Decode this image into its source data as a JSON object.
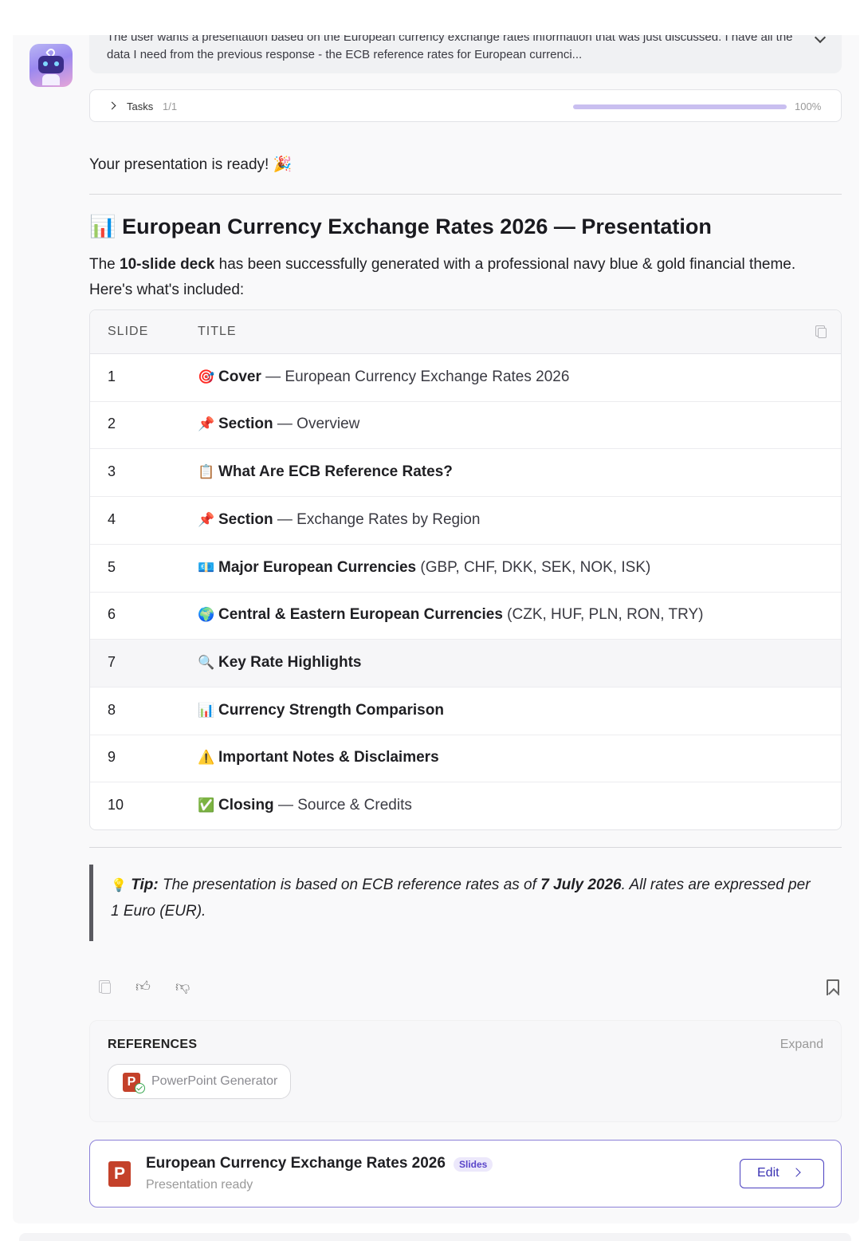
{
  "thinking": {
    "text": "The user wants a presentation based on the European currency exchange rates information that was just discussed. I have all the data I need from the previous response - the ECB reference rates for European currenci..."
  },
  "tasks": {
    "label": "Tasks",
    "count": "1/1",
    "progress": 100,
    "progress_label": "100%"
  },
  "message": {
    "ready": "Your presentation is ready! 🎉",
    "heading_emoji": "📊",
    "heading": "European Currency Exchange Rates 2026 — Presentation",
    "desc_pre": "The ",
    "desc_bold": "10-slide deck",
    "desc_post": " has been successfully generated with a professional navy blue & gold financial theme. Here's what's included:"
  },
  "table": {
    "headers": [
      "SLIDE",
      "TITLE"
    ],
    "rows": [
      {
        "num": "1",
        "emoji": "🎯",
        "bold": "Cover",
        "rest": " — European Currency Exchange Rates 2026"
      },
      {
        "num": "2",
        "emoji": "📌",
        "bold": "Section",
        "rest": " — Overview"
      },
      {
        "num": "3",
        "emoji": "📋",
        "bold": "What Are ECB Reference Rates?",
        "rest": ""
      },
      {
        "num": "4",
        "emoji": "📌",
        "bold": "Section",
        "rest": " — Exchange Rates by Region"
      },
      {
        "num": "5",
        "emoji": "💶",
        "bold": "Major European Currencies",
        "rest": " (GBP, CHF, DKK, SEK, NOK, ISK)"
      },
      {
        "num": "6",
        "emoji": "🌍",
        "bold": "Central & Eastern European Currencies",
        "rest": " (CZK, HUF, PLN, RON, TRY)"
      },
      {
        "num": "7",
        "emoji": "🔍",
        "bold": "Key Rate Highlights",
        "rest": ""
      },
      {
        "num": "8",
        "emoji": "📊",
        "bold": "Currency Strength Comparison",
        "rest": ""
      },
      {
        "num": "9",
        "emoji": "⚠️",
        "bold": "Important Notes & Disclaimers",
        "rest": ""
      },
      {
        "num": "10",
        "emoji": "✅",
        "bold": "Closing",
        "rest": " — Source & Credits"
      }
    ]
  },
  "tip": {
    "emoji": "💡",
    "label": "Tip:",
    "pre": " The presentation is based on ECB reference rates as of ",
    "date": "7 July 2026",
    "post": ". All rates are expressed per 1 Euro (EUR)."
  },
  "references": {
    "title": "REFERENCES",
    "expand": "Expand",
    "chip_label": "PowerPoint Generator",
    "ppt_letter": "P"
  },
  "card": {
    "title": "European Currency Exchange Rates 2026",
    "badge": "Slides",
    "subtitle": "Presentation ready",
    "edit": "Edit",
    "ppt_letter": "P"
  }
}
